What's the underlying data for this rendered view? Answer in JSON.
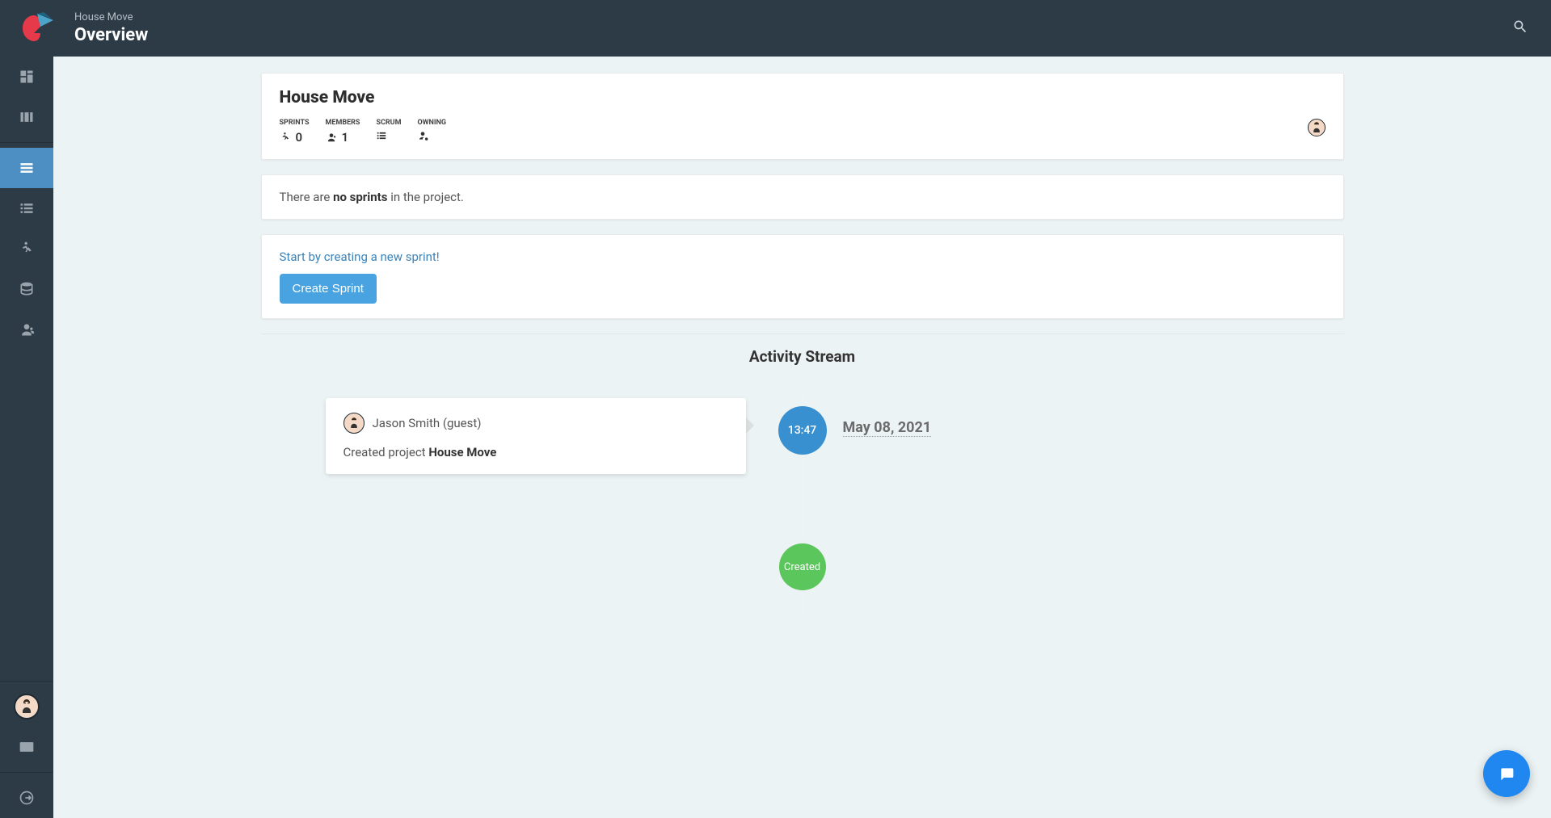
{
  "header": {
    "breadcrumb": "House Move",
    "title": "Overview"
  },
  "project": {
    "title": "House Move",
    "stats": {
      "sprints_label": "SPRINTS",
      "sprints_value": "0",
      "members_label": "MEMBERS",
      "members_value": "1",
      "scrum_label": "SCRUM",
      "owning_label": "OWNING"
    }
  },
  "no_sprints": {
    "prefix": "There are ",
    "bold": "no sprints",
    "suffix": " in the project."
  },
  "create_sprint": {
    "prompt": "Start by creating a new sprint!",
    "button": "Create Sprint"
  },
  "activity": {
    "title": "Activity Stream",
    "time": "13:47",
    "date": "May 08, 2021",
    "user": "Jason Smith (guest)",
    "action_prefix": "Created project ",
    "action_bold": "House Move",
    "created_label": "Created"
  },
  "sidebar": {
    "items": [
      {
        "name": "dashboard"
      },
      {
        "name": "boards"
      },
      {
        "name": "overview"
      },
      {
        "name": "backlog"
      },
      {
        "name": "sprint"
      },
      {
        "name": "database"
      },
      {
        "name": "members"
      }
    ]
  }
}
